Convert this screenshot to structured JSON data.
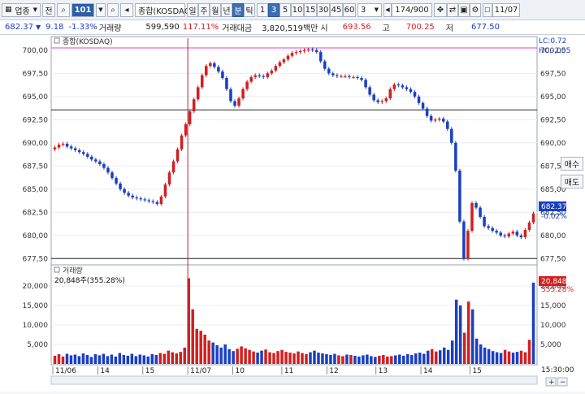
{
  "toolbar": {
    "market": "업종",
    "type_btn": "전",
    "code": "101",
    "period_day": "일",
    "period_week": "주",
    "period_month": "월",
    "period_year": "년",
    "period_min": "분",
    "period_tick": "틱",
    "intervals": [
      "1",
      "3",
      "5",
      "10",
      "15",
      "30",
      "45",
      "60"
    ],
    "interval_value": "3",
    "count": "174/900",
    "date": "11/07"
  },
  "infobar": {
    "price": "682.37",
    "change": "9.18",
    "change_pct": "-1.33%",
    "volume_label": "거래량",
    "volume": "599,590",
    "volume_ratio": "117.11%",
    "amount_label": "거래대금",
    "amount": "3,820,519백만",
    "open_label": "시",
    "open": "693.56",
    "high_label": "고",
    "high": "700.25",
    "low_label": "저",
    "low": "677.50"
  },
  "side": {
    "buy": "매수",
    "sell": "매도"
  },
  "price_panel": {
    "title": "종합(KOSDAQ)",
    "lc": "LC:0.72",
    "hc": "HC:-2.55",
    "current_tag": "682.37",
    "current_change": "-0.02%"
  },
  "volume_panel": {
    "title": "거래량",
    "legend": "20,848주(355.28%)",
    "current_tag": "20,848",
    "current_pct": "355.28%"
  },
  "time_axis": {
    "labels": [
      "11/06",
      "14",
      "15",
      "11/07",
      "10",
      "11",
      "12",
      "13",
      "14",
      "15"
    ],
    "clock": "15:30:00"
  },
  "chart_data": [
    {
      "type": "candlestick",
      "title": "종합(KOSDAQ)",
      "y_ticks": [
        "700,00",
        "697,50",
        "695,00",
        "692,50",
        "690,00",
        "687,50",
        "685,00",
        "682,50",
        "680,00",
        "677,50"
      ],
      "ylim": [
        677.0,
        701.3
      ],
      "reference_lines": [
        700.25,
        693.56,
        677.5
      ],
      "close_series": [
        689.5,
        689.8,
        689.9,
        689.6,
        689.4,
        689.2,
        689.0,
        688.8,
        688.5,
        688.2,
        688.0,
        687.7,
        687.3,
        686.8,
        686.2,
        685.6,
        685.0,
        684.6,
        684.3,
        684.1,
        684.0,
        683.9,
        683.8,
        683.7,
        683.6,
        683.4,
        684.2,
        685.5,
        686.8,
        688.0,
        689.3,
        690.8,
        692.0,
        693.4,
        694.7,
        696.0,
        697.3,
        698.3,
        698.6,
        698.2,
        697.7,
        697.0,
        695.8,
        694.5,
        694.0,
        694.8,
        695.8,
        696.6,
        697.1,
        697.3,
        697.2,
        697.1,
        697.5,
        697.8,
        698.3,
        698.7,
        699.0,
        699.4,
        699.7,
        699.8,
        699.9,
        700.0,
        700.1,
        700.0,
        699.8,
        698.8,
        698.0,
        697.5,
        697.3,
        697.2,
        697.2,
        697.2,
        697.1,
        697.1,
        697.0,
        696.8,
        696.0,
        695.2,
        694.6,
        694.4,
        694.5,
        694.8,
        695.8,
        696.3,
        696.2,
        696.0,
        695.8,
        695.5,
        695.0,
        694.3,
        693.7,
        692.9,
        692.4,
        692.5,
        692.6,
        692.3,
        691.5,
        690.0,
        687.0,
        681.5,
        677.5,
        680.5,
        683.5,
        683.0,
        682.0,
        681.0,
        680.8,
        680.5,
        680.3,
        680.0,
        679.9,
        680.2,
        680.4,
        680.0,
        679.8,
        680.6,
        681.4,
        682.37
      ],
      "colors": {
        "up": "#d21f1f",
        "down": "#1a3fc2"
      }
    },
    {
      "type": "bar",
      "title": "거래량",
      "y_ticks": [
        "20,000",
        "15,000",
        "10,000",
        "5,000"
      ],
      "ylim": [
        0,
        22500
      ],
      "values": [
        2100,
        2500,
        1900,
        2600,
        2200,
        2400,
        2000,
        2700,
        2300,
        1800,
        2500,
        2200,
        2600,
        2000,
        2400,
        1900,
        2800,
        2300,
        2100,
        2600,
        2000,
        2400,
        2200,
        1900,
        2500,
        2300,
        2800,
        2600,
        3400,
        3000,
        2700,
        3100,
        4200,
        22000,
        14000,
        9000,
        8500,
        7500,
        6000,
        5500,
        4800,
        4200,
        5000,
        3800,
        3300,
        3900,
        4500,
        4000,
        3600,
        3200,
        2900,
        3400,
        3700,
        3000,
        2800,
        3300,
        3600,
        3100,
        2900,
        2700,
        3200,
        2800,
        2500,
        3000,
        3400,
        2900,
        2700,
        2500,
        2300,
        2600,
        2200,
        2000,
        2400,
        2300,
        2100,
        1900,
        2200,
        2400,
        2000,
        1800,
        2100,
        2300,
        1900,
        2000,
        2200,
        2400,
        2100,
        2500,
        2300,
        2700,
        2900,
        2600,
        3400,
        3800,
        3200,
        3500,
        4200,
        3600,
        6000,
        16500,
        15000,
        8000,
        16000,
        14000,
        6500,
        5000,
        4200,
        3800,
        3300,
        3000,
        2800,
        3600,
        3200,
        2900,
        3100,
        3400,
        3000,
        6200,
        20848
      ],
      "colors": {
        "up": "#d21f1f",
        "down": "#1a3fc2"
      }
    }
  ]
}
